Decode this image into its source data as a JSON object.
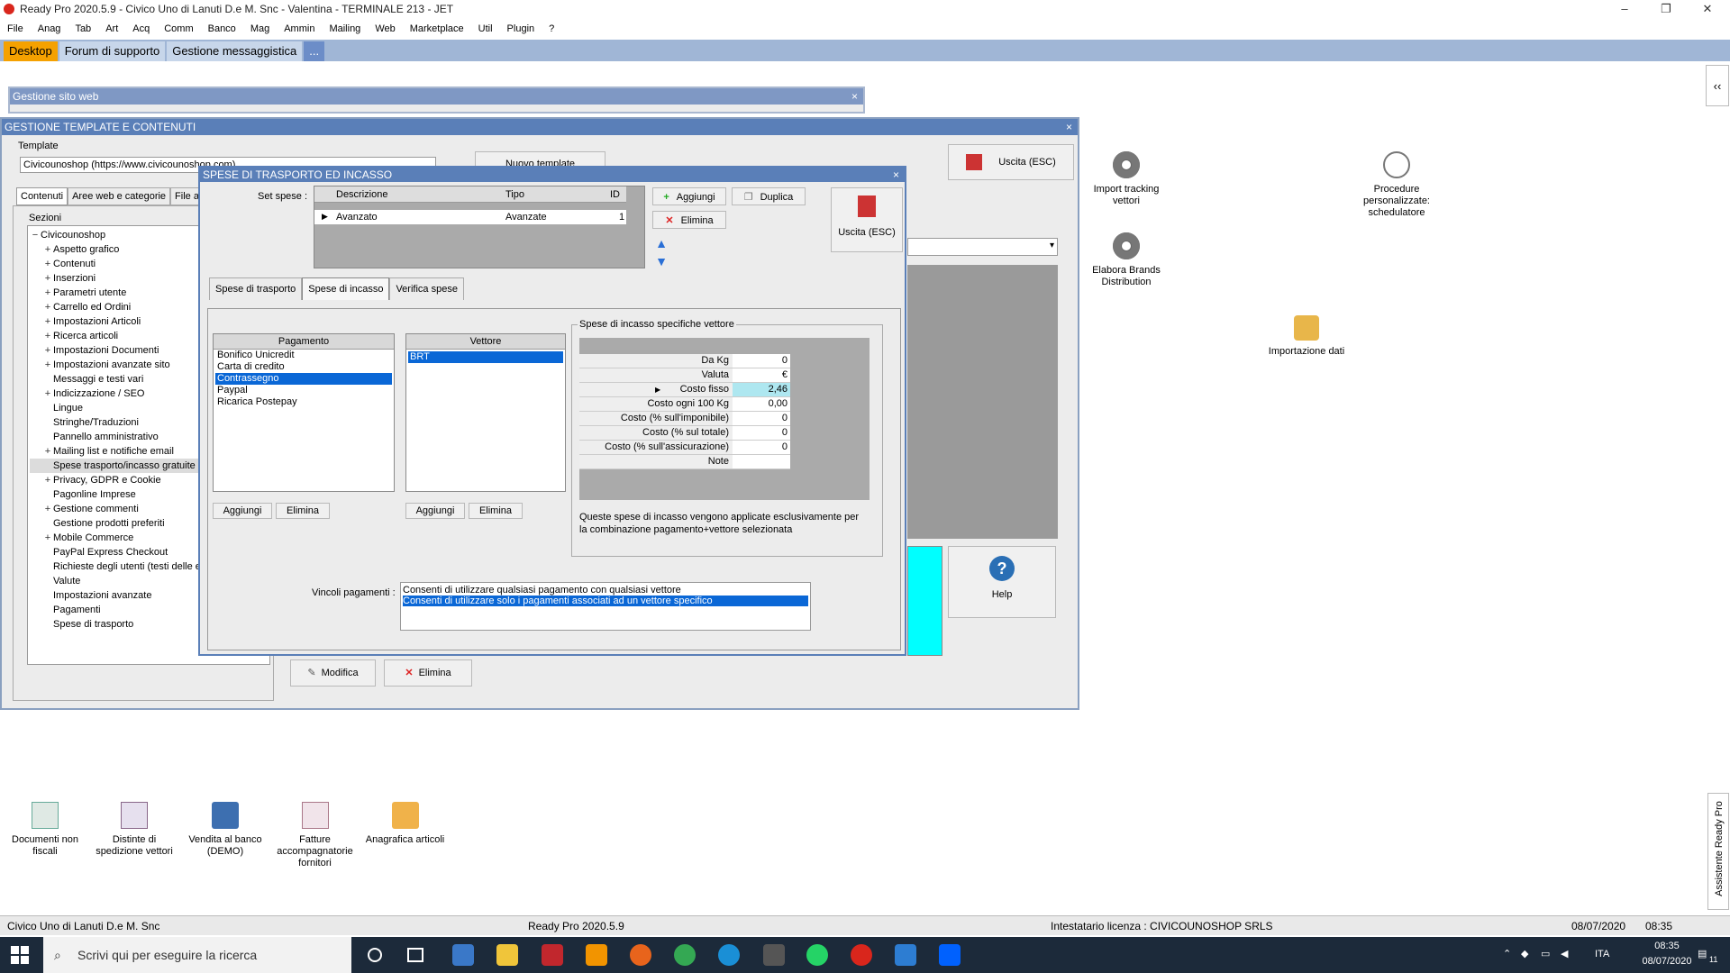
{
  "app": {
    "title": "Ready Pro 2020.5.9 - Civico Uno di Lanuti D.e M. Snc - Valentina - TERMINALE 213 - JET"
  },
  "menu": [
    "File",
    "Anag",
    "Tab",
    "Art",
    "Acq",
    "Comm",
    "Banco",
    "Mag",
    "Ammin",
    "Mailing",
    "Web",
    "Marketplace",
    "Util",
    "Plugin",
    "?"
  ],
  "tabs": {
    "desktop": "Desktop",
    "forum": "Forum di supporto",
    "messaggistica": "Gestione messaggistica",
    "more": "..."
  },
  "window_sito": {
    "title": "Gestione sito web",
    "close": "×"
  },
  "window_template": {
    "title": "GESTIONE TEMPLATE E CONTENUTI",
    "close": "×",
    "template_label": "Template",
    "template_value": "Civicounoshop (https://www.civicounoshop.com)",
    "nuovo_template": "Nuovo template",
    "uscita": "Uscita (ESC)",
    "tabs": [
      "Contenuti",
      "Aree web e categorie",
      "File a"
    ],
    "sezioni_label": "Sezioni",
    "tree_root": "Civicounoshop",
    "tree": [
      {
        "label": "Aspetto grafico",
        "exp": "+"
      },
      {
        "label": "Contenuti",
        "exp": "+"
      },
      {
        "label": "Inserzioni",
        "exp": "+"
      },
      {
        "label": "Parametri utente",
        "exp": "+"
      },
      {
        "label": "Carrello ed Ordini",
        "exp": "+"
      },
      {
        "label": "Impostazioni Articoli",
        "exp": "+"
      },
      {
        "label": "Ricerca articoli",
        "exp": "+"
      },
      {
        "label": "Impostazioni Documenti",
        "exp": "+"
      },
      {
        "label": "Impostazioni avanzate sito",
        "exp": "+"
      },
      {
        "label": "Messaggi e testi vari",
        "exp": ""
      },
      {
        "label": "Indicizzazione / SEO",
        "exp": "+"
      },
      {
        "label": "Lingue",
        "exp": ""
      },
      {
        "label": "Stringhe/Traduzioni",
        "exp": ""
      },
      {
        "label": "Pannello amministrativo",
        "exp": ""
      },
      {
        "label": "Mailing list e notifiche email",
        "exp": "+"
      },
      {
        "label": "Spese trasporto/incasso gratuite",
        "exp": ""
      },
      {
        "label": "Privacy, GDPR e Cookie",
        "exp": "+"
      },
      {
        "label": "Pagonline Imprese",
        "exp": ""
      },
      {
        "label": "Gestione commenti",
        "exp": "+"
      },
      {
        "label": "Gestione prodotti preferiti",
        "exp": ""
      },
      {
        "label": "Mobile Commerce",
        "exp": "+"
      },
      {
        "label": "PayPal Express Checkout",
        "exp": ""
      },
      {
        "label": "Richieste degli utenti (testi delle e",
        "exp": ""
      },
      {
        "label": "Valute",
        "exp": ""
      },
      {
        "label": "Impostazioni avanzate",
        "exp": ""
      },
      {
        "label": "Pagamenti",
        "exp": ""
      },
      {
        "label": "Spese di trasporto",
        "exp": ""
      }
    ],
    "modifica": "Modifica",
    "elimina": "Elimina",
    "help": "Help"
  },
  "dialog": {
    "title": "SPESE DI TRASPORTO ED INCASSO",
    "close": "×",
    "set_spese_label": "Set spese :",
    "set_cols": [
      "Descrizione",
      "Tipo",
      "ID"
    ],
    "set_rows": [
      {
        "descrizione": "Avanzato",
        "tipo": "Avanzate",
        "id": "1"
      }
    ],
    "aggiungi": "Aggiungi",
    "duplica": "Duplica",
    "elimina": "Elimina",
    "uscita": "Uscita (ESC)",
    "tabs": [
      "Spese di trasporto",
      "Spese di incasso",
      "Verifica spese"
    ],
    "pagamento_header": "Pagamento",
    "pagamenti": [
      "Bonifico Unicredit",
      "Carta di credito",
      "Contrassegno",
      "Paypal",
      "Ricarica Postepay"
    ],
    "vettore_header": "Vettore",
    "vettori": [
      "BRT"
    ],
    "btn_aggiungi": "Aggiungi",
    "btn_elimina": "Elimina",
    "group_title": "Spese di incasso specifiche vettore",
    "fields": [
      {
        "label": "Da Kg",
        "value": "0"
      },
      {
        "label": "Valuta",
        "value": "€"
      },
      {
        "label": "Costo fisso",
        "value": "2,46"
      },
      {
        "label": "Costo ogni 100 Kg",
        "value": "0,00"
      },
      {
        "label": "Costo (% sull'imponibile)",
        "value": "0"
      },
      {
        "label": "Costo (% sul totale)",
        "value": "0"
      },
      {
        "label": "Costo (% sull'assicurazione)",
        "value": "0"
      },
      {
        "label": "Note",
        "value": ""
      }
    ],
    "note_text": "Queste spese di incasso vengono applicate esclusivamente per la combinazione pagamento+vettore selezionata",
    "vincoli_label": "Vincoli pagamenti :",
    "vincoli": [
      "Consenti di utilizzare qualsiasi pagamento con qualsiasi vettore",
      "Consenti di utilizzare solo i pagamenti associati ad un vettore specifico"
    ]
  },
  "desktop_icons": {
    "import_tracking": "Import tracking vettori",
    "procedure": "Procedure personalizzate: schedulatore",
    "elabora": "Elabora Brands Distribution",
    "importazione": "Importazione dati",
    "documenti": "Documenti non fiscali",
    "distinte": "Distinte di spedizione vettori",
    "vendita": "Vendita al banco (DEMO)",
    "fatture": "Fatture accompagnatorie fornitori",
    "anagrafica": "Anagrafica articoli",
    "assistente": "Assistente Ready Pro"
  },
  "status": {
    "company": "Civico Uno di Lanuti D.e M. Snc",
    "version": "Ready Pro 2020.5.9",
    "license": "Intestatario licenza : CIVICOUNOSHOP SRLS",
    "date": "08/07/2020",
    "time": "08:35"
  },
  "taskbar": {
    "search_placeholder": "Scrivi qui per eseguire la ricerca",
    "lang": "ITA",
    "time": "08:35",
    "date": "08/07/2020",
    "notif": "11"
  }
}
